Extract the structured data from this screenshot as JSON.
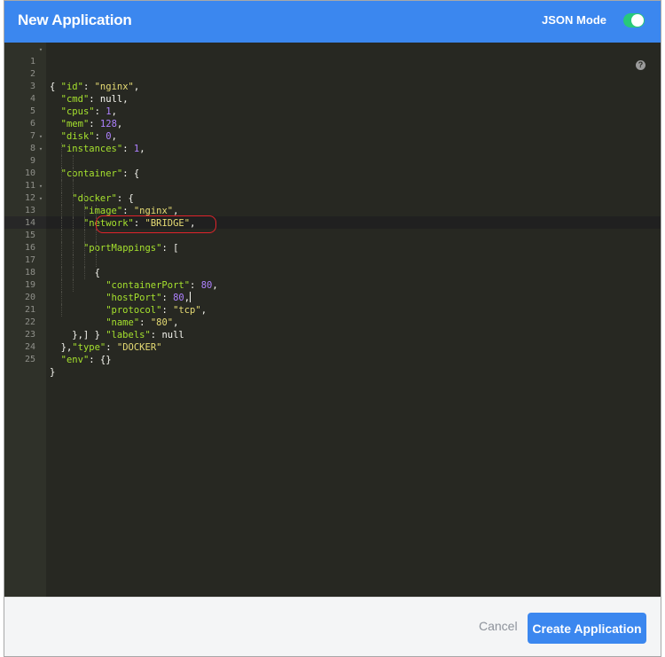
{
  "header": {
    "title": "New Application",
    "json_mode_label": "JSON Mode",
    "json_mode_enabled": true
  },
  "editor": {
    "help_symbol": "?",
    "active_line": 15,
    "lines": [
      {
        "n": "1",
        "fold": "▾"
      },
      {
        "n": "2"
      },
      {
        "n": "3"
      },
      {
        "n": "4"
      },
      {
        "n": "5"
      },
      {
        "n": "6"
      },
      {
        "n": "7"
      },
      {
        "n": "8",
        "fold": "▾"
      },
      {
        "n": "9",
        "fold": "▾"
      },
      {
        "n": "10"
      },
      {
        "n": "11"
      },
      {
        "n": "12",
        "fold": "▾"
      },
      {
        "n": "13",
        "fold": "▾"
      },
      {
        "n": "14"
      },
      {
        "n": "15"
      },
      {
        "n": "16"
      },
      {
        "n": "17"
      },
      {
        "n": "18"
      },
      {
        "n": "19"
      },
      {
        "n": "20"
      },
      {
        "n": "21"
      },
      {
        "n": "22"
      },
      {
        "n": "23"
      },
      {
        "n": "24"
      },
      {
        "n": "25"
      }
    ],
    "tokens": {
      "l2_key": "\"id\"",
      "l2_val": "\"nginx\"",
      "l3_key": "\"cmd\"",
      "l3_val": "null",
      "l4_key": "\"cpus\"",
      "l4_val": "1",
      "l5_key": "\"mem\"",
      "l5_val": "128",
      "l6_key": "\"disk\"",
      "l6_val": "0",
      "l7_key": "\"instances\"",
      "l7_val": "1",
      "l8_key": "\"container\"",
      "l9_key": "\"docker\"",
      "l10_key": "\"image\"",
      "l10_val": "\"nginx\"",
      "l11_key": "\"network\"",
      "l11_val": "\"BRIDGE\"",
      "l12_key": "\"portMappings\"",
      "l14_key": "\"containerPort\"",
      "l14_val": "80",
      "l15_key": "\"hostPort\"",
      "l15_val": "80",
      "l16_key": "\"protocol\"",
      "l16_val": "\"tcp\"",
      "l17_key": "\"name\"",
      "l17_val": "\"80\"",
      "l18_key": "\"labels\"",
      "l18_val": "null",
      "l22_key": "\"type\"",
      "l22_val": "\"DOCKER\"",
      "l24_key": "\"env\"",
      "l24_val": "{}"
    }
  },
  "footer": {
    "cancel_label": "Cancel",
    "create_label": "Create Application"
  }
}
